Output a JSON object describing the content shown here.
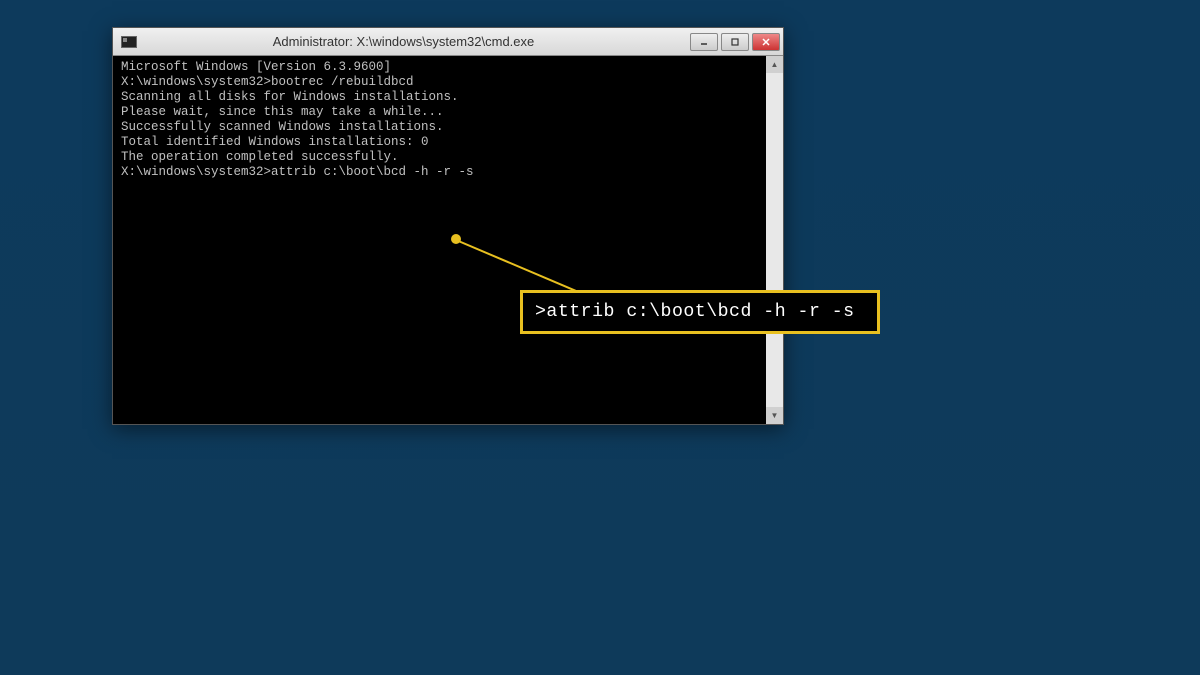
{
  "window": {
    "title": "Administrator: X:\\windows\\system32\\cmd.exe"
  },
  "terminal": {
    "lines": [
      "Microsoft Windows [Version 6.3.9600]",
      "",
      "X:\\windows\\system32>bootrec /rebuildbcd",
      "Scanning all disks for Windows installations.",
      "",
      "Please wait, since this may take a while...",
      "",
      "Successfully scanned Windows installations.",
      "Total identified Windows installations: 0",
      "The operation completed successfully.",
      "",
      "X:\\windows\\system32>attrib c:\\boot\\bcd -h -r -s"
    ]
  },
  "callout": {
    "text": ">attrib c:\\boot\\bcd -h -r -s"
  }
}
